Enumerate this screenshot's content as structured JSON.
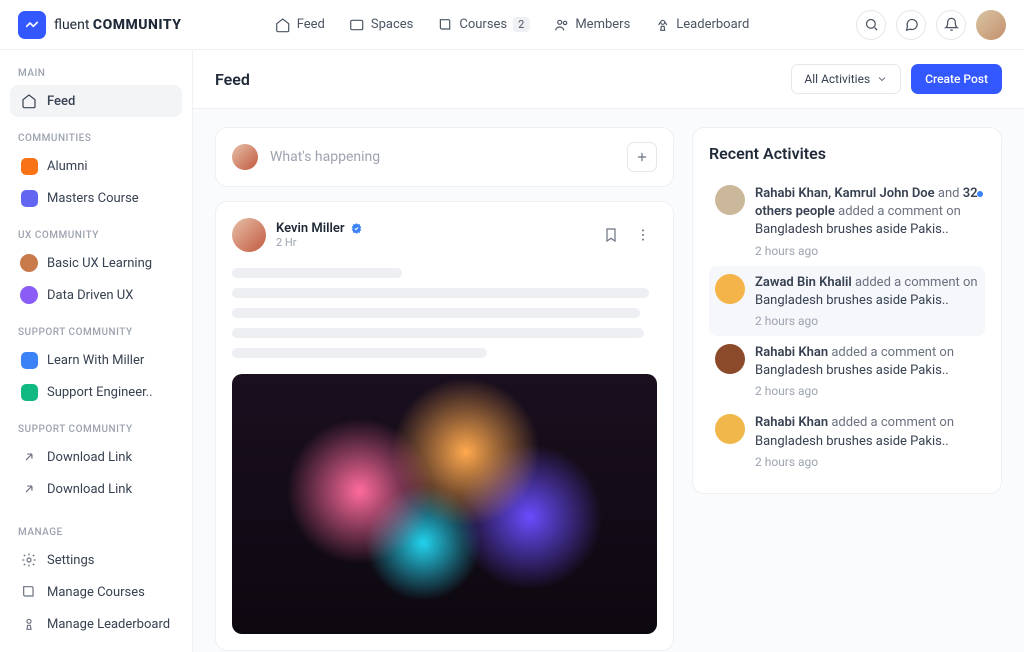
{
  "brand": {
    "prefix": "fluent",
    "suffix": "COMMUNITY"
  },
  "topnav": {
    "feed": "Feed",
    "spaces": "Spaces",
    "courses": "Courses",
    "courses_badge": "2",
    "members": "Members",
    "leaderboard": "Leaderboard"
  },
  "page": {
    "title": "Feed",
    "filter_label": "All Activities",
    "create_label": "Create Post"
  },
  "sidebar": {
    "main_label": "MAIN",
    "feed": "Feed",
    "communities_label": "COMMUNITIES",
    "alumni": "Alumni",
    "masters": "Masters Course",
    "ux_label": "UX COMMUNITY",
    "basic_ux": "Basic UX Learning",
    "data_ux": "Data Driven UX",
    "support_label": "SUPPORT COMMUNITY",
    "learn_miller": "Learn With Miller",
    "support_eng": "Support Engineer..",
    "support2_label": "SUPPORT COMMUNITY",
    "dl1": "Download Link",
    "dl2": "Download Link",
    "manage_label": "MANAGE",
    "settings": "Settings",
    "manage_courses": "Manage Courses",
    "manage_lb": "Manage Leaderboard"
  },
  "composer": {
    "placeholder": "What's happening"
  },
  "post": {
    "author": "Kevin Miller",
    "time": "2 Hr"
  },
  "activities": {
    "title": "Recent Activites",
    "items": [
      {
        "authors": "Rahabi Khan, Kamrul John Doe",
        "connector": " and ",
        "extra": "32 others people",
        "action": " added a comment on ",
        "subject": "Bangladesh brushes aside Pakis..",
        "time": "2 hours ago",
        "color": "#cbb89a",
        "unread": true
      },
      {
        "authors": "Zawad Bin Khalil",
        "connector": "",
        "extra": "",
        "action": " added a comment on ",
        "subject": "Bangladesh brushes aside Pakis..",
        "time": "2 hours ago",
        "color": "#f5b44a",
        "highlight": true
      },
      {
        "authors": "Rahabi Khan",
        "connector": "",
        "extra": "",
        "action": " added a comment on ",
        "subject": "Bangladesh brushes aside Pakis..",
        "time": "2 hours ago",
        "color": "#8b4a2a"
      },
      {
        "authors": "Rahabi Khan",
        "connector": "",
        "extra": "",
        "action": " added a comment on ",
        "subject": "Bangladesh brushes aside Pakis..",
        "time": "2 hours ago",
        "color": "#f0b84a"
      }
    ]
  }
}
